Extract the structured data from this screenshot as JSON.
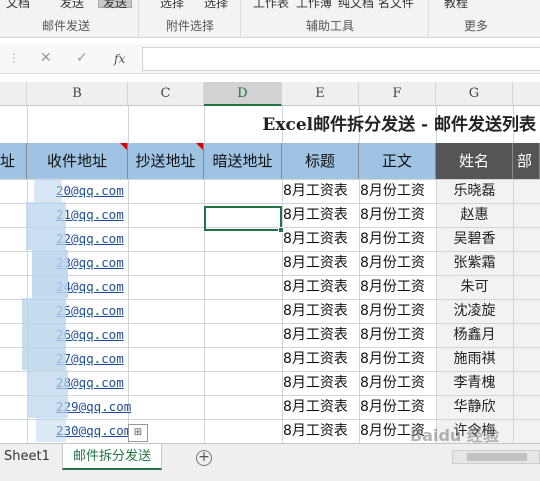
{
  "ribbon": {
    "buttons": [
      "文档",
      "发送",
      "发送",
      "选择",
      "选择",
      "工作表",
      "工作薄",
      "纯文档",
      "名文件",
      "教程"
    ],
    "groups": [
      "邮件发送",
      "附件选择",
      "辅助工具",
      "更多"
    ]
  },
  "formula_bar": {
    "cancel": "✕",
    "confirm": "✓",
    "fx": "fx",
    "value": ""
  },
  "columns": [
    "B",
    "C",
    "D",
    "E",
    "F",
    "G"
  ],
  "sheet": {
    "title": "Excel邮件拆分发送 - 邮件发送列表",
    "headers": [
      "址",
      "收件地址",
      "抄送地址",
      "暗送地址",
      "标题",
      "正文",
      "姓名",
      "部"
    ],
    "rows": [
      {
        "email": "20@qq.com",
        "subject": "8月工资表",
        "body": "8月份工资",
        "name": "乐晓磊"
      },
      {
        "email": "21@qq.com",
        "subject": "8月工资表",
        "body": "8月份工资",
        "name": "赵惠"
      },
      {
        "email": "22@qq.com",
        "subject": "8月工资表",
        "body": "8月份工资",
        "name": "吴碧香"
      },
      {
        "email": "23@qq.com",
        "subject": "8月工资表",
        "body": "8月份工资",
        "name": "张紫霜"
      },
      {
        "email": "24@qq.com",
        "subject": "8月工资表",
        "body": "8月份工资",
        "name": "朱可"
      },
      {
        "email": "25@qq.com",
        "subject": "8月工资表",
        "body": "8月份工资",
        "name": "沈凌旋"
      },
      {
        "email": "26@qq.com",
        "subject": "8月工资表",
        "body": "8月份工资",
        "name": "杨鑫月"
      },
      {
        "email": "27@qq.com",
        "subject": "8月工资表",
        "body": "8月份工资",
        "name": "施雨祺"
      },
      {
        "email": "28@qq.com",
        "subject": "8月工资表",
        "body": "8月份工资",
        "name": "李青槐"
      },
      {
        "email": "229@qq.com",
        "subject": "8月工资表",
        "body": "8月份工资",
        "name": "华静欣"
      },
      {
        "email": "230@qq.com",
        "subject": "8月工资表",
        "body": "8月份工资",
        "name": "许令梅"
      }
    ]
  },
  "tabs": {
    "sheet1": "Sheet1",
    "active": "邮件拆分发送",
    "add": "+"
  },
  "watermark": "Baidu 经验"
}
